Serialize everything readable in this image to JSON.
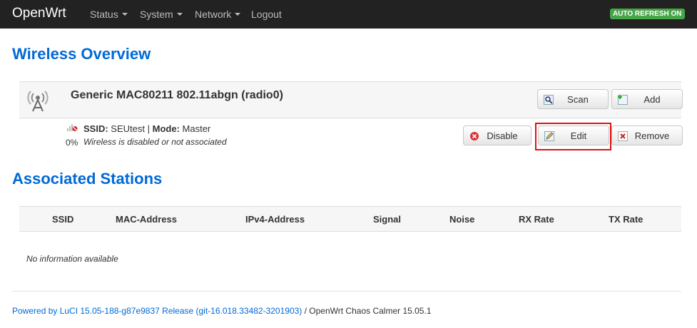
{
  "navbar": {
    "brand": "OpenWrt",
    "items": [
      {
        "label": "Status"
      },
      {
        "label": "System"
      },
      {
        "label": "Network"
      },
      {
        "label": "Logout"
      }
    ],
    "auto_refresh": "AUTO REFRESH ON"
  },
  "wireless": {
    "title": "Wireless Overview",
    "radio": {
      "name": "Generic MAC80211 802.11abgn (radio0)",
      "scan_label": "Scan",
      "add_label": "Add"
    },
    "network": {
      "ssid_label": "SSID:",
      "ssid_value": "SEUtest",
      "separator": "|",
      "mode_label": "Mode:",
      "mode_value": "Master",
      "signal_percent": "0%",
      "status": "Wireless is disabled or not associated",
      "disable_label": "Disable",
      "edit_label": "Edit",
      "remove_label": "Remove"
    }
  },
  "stations": {
    "title": "Associated Stations",
    "columns": [
      "SSID",
      "MAC-Address",
      "IPv4-Address",
      "Signal",
      "Noise",
      "RX Rate",
      "TX Rate"
    ],
    "empty_text": "No information available"
  },
  "footer": {
    "link_text": "Powered by LuCI 15.05-188-g87e9837 Release (git-16.018.33482-3201903)",
    "suffix": " / OpenWrt Chaos Calmer 15.05.1"
  },
  "colors": {
    "heading": "#0069d6",
    "navbar": "#222222",
    "auto_refresh": "#46a546",
    "highlight": "#dd1111"
  }
}
